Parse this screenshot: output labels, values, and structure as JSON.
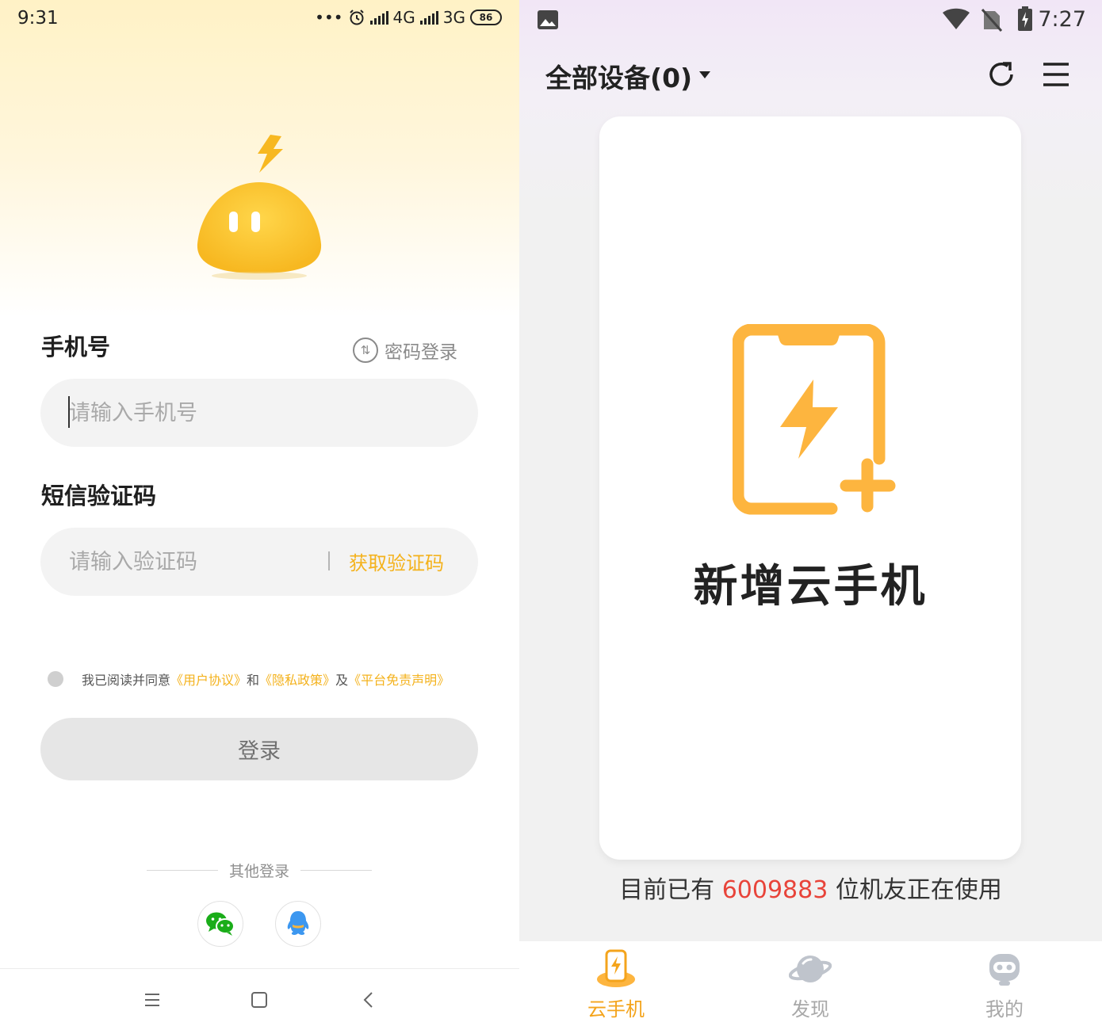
{
  "left": {
    "status_bar": {
      "time": "9:31",
      "dots": "•••",
      "network1": "4G",
      "network2": "3G",
      "battery": "86"
    },
    "phone": {
      "label": "手机号",
      "placeholder": "请输入手机号"
    },
    "password_login": {
      "icon_text": "⇅",
      "label": "密码登录"
    },
    "sms": {
      "label": "短信验证码",
      "placeholder": "请输入验证码",
      "get_code": "获取验证码"
    },
    "agreement": {
      "prefix": "我已阅读并同意",
      "user_agreement": "《用户协议》",
      "and": "和",
      "privacy": "《隐私政策》",
      "also": "及",
      "disclaimer": "《平台免责声明》"
    },
    "login_button": "登录",
    "other_login": "其他登录"
  },
  "right": {
    "status_bar": {
      "time": "7:27"
    },
    "header": {
      "title": "全部设备(0)"
    },
    "card": {
      "title": "新增云手机"
    },
    "users": {
      "prefix": "目前已有",
      "count": "6009883",
      "suffix": "位机友正在使用"
    },
    "tabs": [
      {
        "label": "云手机",
        "icon": "cloud-phone-icon",
        "active": true
      },
      {
        "label": "发现",
        "icon": "planet-icon",
        "active": false
      },
      {
        "label": "我的",
        "icon": "robot-icon",
        "active": false
      }
    ]
  },
  "colors": {
    "accent": "#f4b21c",
    "highlight_red": "#e8443a",
    "icon_orange": "#fdb53f"
  }
}
